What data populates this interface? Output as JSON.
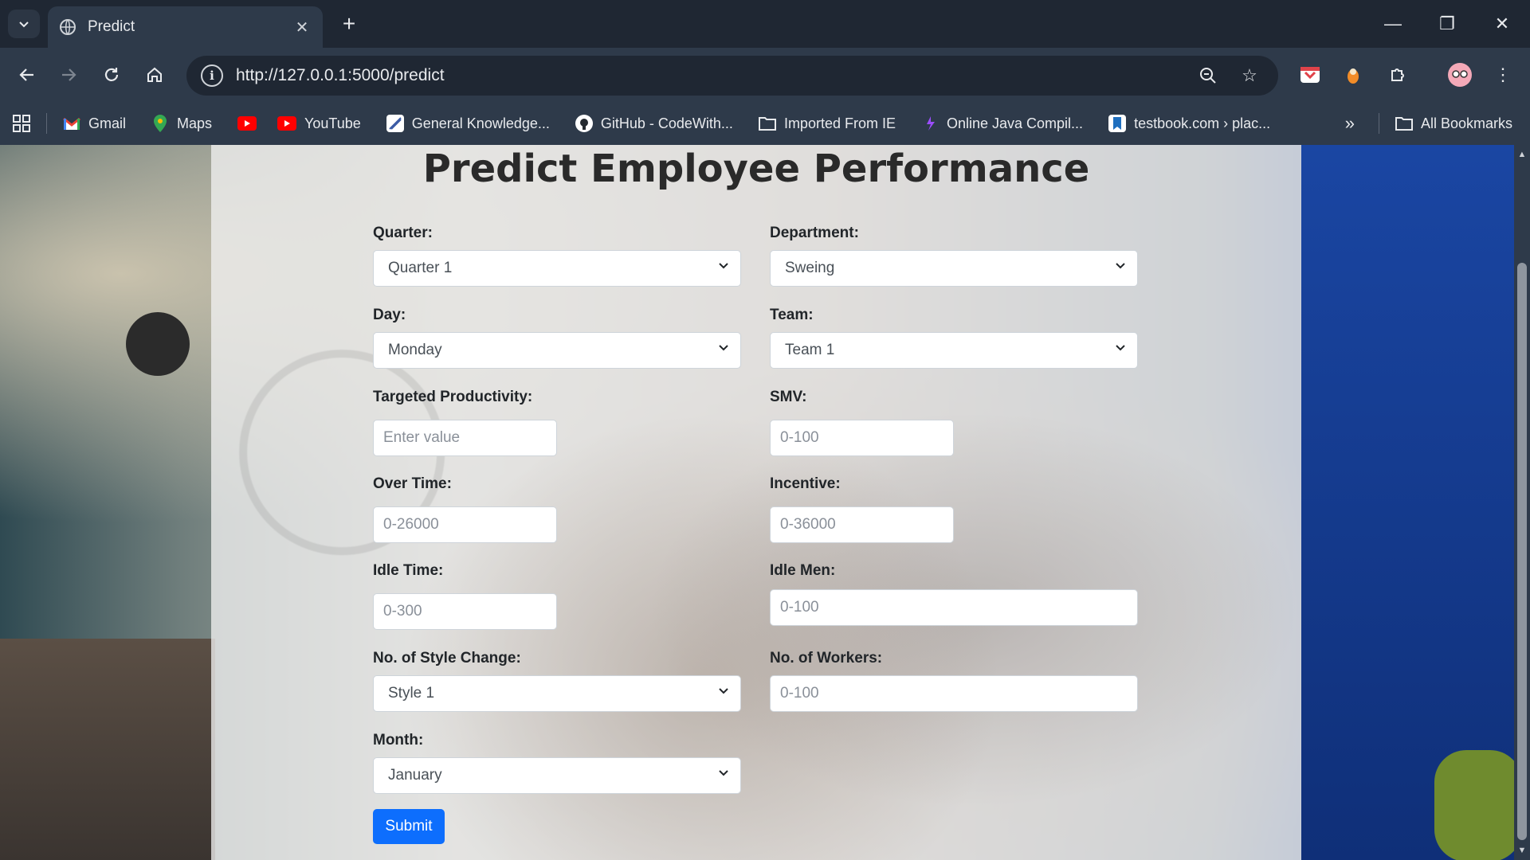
{
  "browser": {
    "tab_title": "Predict",
    "url": "http://127.0.0.1:5000/predict",
    "bookmarks": [
      {
        "label": "Gmail",
        "icon": "gmail-icon"
      },
      {
        "label": "Maps",
        "icon": "maps-icon"
      },
      {
        "label": "",
        "icon": "youtube-icon"
      },
      {
        "label": "YouTube",
        "icon": "youtube-icon"
      },
      {
        "label": "General Knowledge...",
        "icon": "gk-icon"
      },
      {
        "label": "GitHub - CodeWith...",
        "icon": "github-icon"
      },
      {
        "label": "Imported From IE",
        "icon": "folder-icon"
      },
      {
        "label": "Online Java Compil...",
        "icon": "java-icon"
      },
      {
        "label": "testbook.com › plac...",
        "icon": "testbook-icon"
      }
    ],
    "all_bookmarks": "All Bookmarks"
  },
  "page": {
    "title": "Predict Employee Performance",
    "fields": {
      "quarter": {
        "label": "Quarter:",
        "value": "Quarter 1"
      },
      "department": {
        "label": "Department:",
        "value": "Sweing"
      },
      "day": {
        "label": "Day:",
        "value": "Monday"
      },
      "team": {
        "label": "Team:",
        "value": "Team 1"
      },
      "targeted_productivity": {
        "label": "Targeted Productivity:",
        "placeholder": "Enter value"
      },
      "smv": {
        "label": "SMV:",
        "placeholder": "0-100"
      },
      "over_time": {
        "label": "Over Time:",
        "placeholder": "0-26000"
      },
      "incentive": {
        "label": "Incentive:",
        "placeholder": "0-36000"
      },
      "idle_time": {
        "label": "Idle Time:",
        "placeholder": "0-300"
      },
      "idle_men": {
        "label": "Idle Men:",
        "placeholder": "0-100"
      },
      "style_change": {
        "label": "No. of Style Change:",
        "value": "Style 1"
      },
      "workers": {
        "label": "No. of Workers:",
        "placeholder": "0-100"
      },
      "month": {
        "label": "Month:",
        "value": "January"
      }
    },
    "submit_label": "Submit"
  },
  "colors": {
    "accent": "#0d6efd",
    "chrome": "#2e3a4a"
  }
}
